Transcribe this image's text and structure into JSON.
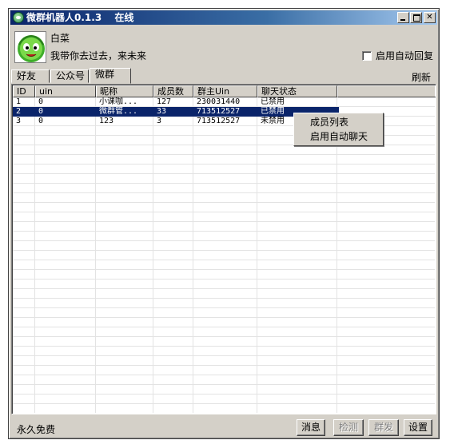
{
  "window": {
    "app_title": "微群机器人0.1.3",
    "status": "在线",
    "app_icon": "wechat-icon"
  },
  "profile": {
    "nickname": "白菜",
    "signature": "我带你去过去，来未来",
    "avatar_icon": "green-cabbage-avatar"
  },
  "auto_reply": {
    "label": "启用自动回复",
    "checked": false
  },
  "tabs": [
    {
      "label": "好友",
      "active": false
    },
    {
      "label": "公众号",
      "active": false
    },
    {
      "label": "微群",
      "active": true
    }
  ],
  "refresh_label": "刷新",
  "table": {
    "headers": [
      "ID",
      "uin",
      "昵称",
      "成员数",
      "群主Uin",
      "聊天状态"
    ],
    "rows": [
      {
        "id": "1",
        "uin": "0",
        "nickname": "小课咖...",
        "members": "127",
        "owner_uin": "230031440",
        "chat_status": "已禁用",
        "selected": false
      },
      {
        "id": "2",
        "uin": "0",
        "nickname": "微群管...",
        "members": "33",
        "owner_uin": "713512527",
        "chat_status": "已禁用",
        "selected": true
      },
      {
        "id": "3",
        "uin": "0",
        "nickname": "123",
        "members": "3",
        "owner_uin": "713512527",
        "chat_status": "未禁用",
        "selected": false
      }
    ]
  },
  "context_menu": {
    "items": [
      {
        "label": "成员列表"
      },
      {
        "label": "启用自动聊天"
      }
    ]
  },
  "status_text": "永久免费",
  "buttons": {
    "message": {
      "label": "消息",
      "enabled": true
    },
    "check": {
      "label": "检测",
      "enabled": false
    },
    "group_send": {
      "label": "群发",
      "enabled": false
    },
    "settings": {
      "label": "设置",
      "enabled": true
    }
  }
}
